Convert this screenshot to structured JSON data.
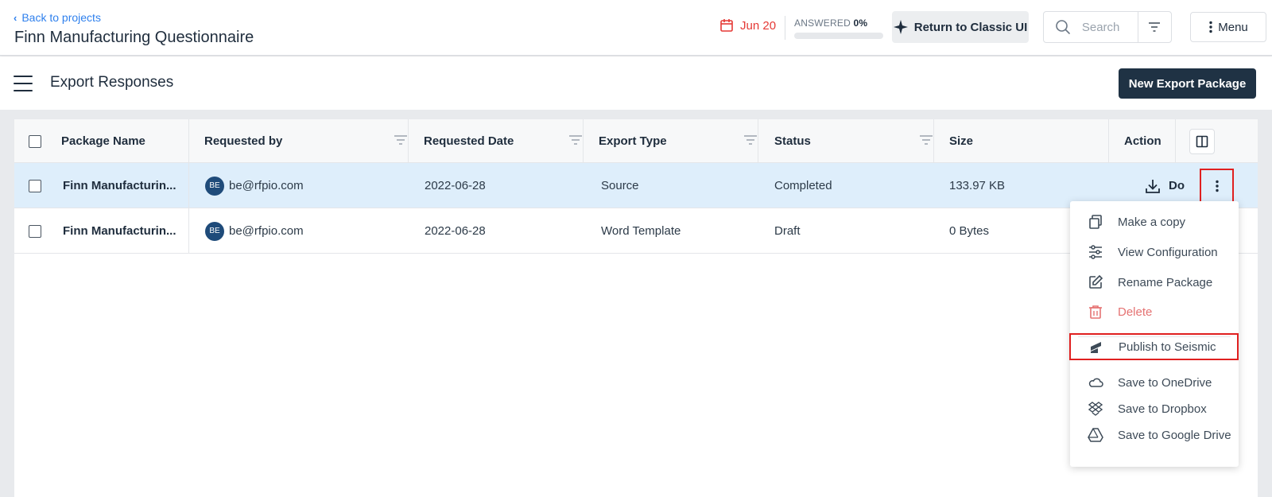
{
  "header": {
    "back_label": "Back to projects",
    "project_title": "Finn Manufacturing Questionnaire",
    "due_date": "Jun 20",
    "answered_label": "ANSWERED",
    "answered_percent": "0%",
    "answered_fraction": 0,
    "classic_ui_label": "Return to Classic UI",
    "search_placeholder": "Search",
    "menu_label": "Menu"
  },
  "subheader": {
    "page_title": "Export Responses",
    "new_export_label": "New Export Package"
  },
  "table": {
    "columns": [
      "Package Name",
      "Requested by",
      "Requested Date",
      "Export Type",
      "Status",
      "Size",
      "Action"
    ],
    "rows": [
      {
        "package_name": "Finn Manufacturin...",
        "avatar_initials": "BE",
        "requested_by": "be@rfpio.com",
        "requested_date": "2022-06-28",
        "export_type": "Source",
        "status": "Completed",
        "size": "133.97 KB",
        "action_label": "Do",
        "selected": true
      },
      {
        "package_name": "Finn Manufacturin...",
        "avatar_initials": "BE",
        "requested_by": "be@rfpio.com",
        "requested_date": "2022-06-28",
        "export_type": "Word Template",
        "status": "Draft",
        "size": "0 Bytes",
        "selected": false
      }
    ]
  },
  "dropdown": {
    "items": [
      {
        "label": "Make a copy",
        "icon": "copy-icon"
      },
      {
        "label": "View Configuration",
        "icon": "sliders-icon"
      },
      {
        "label": "Rename Package",
        "icon": "rename-icon"
      },
      {
        "label": "Delete",
        "icon": "trash-icon"
      },
      {
        "label": "Publish to Seismic",
        "icon": "seismic-icon"
      },
      {
        "label": "Save to OneDrive",
        "icon": "onedrive-icon"
      },
      {
        "label": "Save to Dropbox",
        "icon": "dropbox-icon"
      },
      {
        "label": "Save to Google Drive",
        "icon": "google-drive-icon"
      }
    ]
  },
  "colors": {
    "accent": "#2f80ed",
    "due": "#e53935",
    "primary_button": "#1f3244",
    "selected_row": "#deeefb",
    "danger": "#e57373",
    "highlight_box": "#e02020"
  }
}
